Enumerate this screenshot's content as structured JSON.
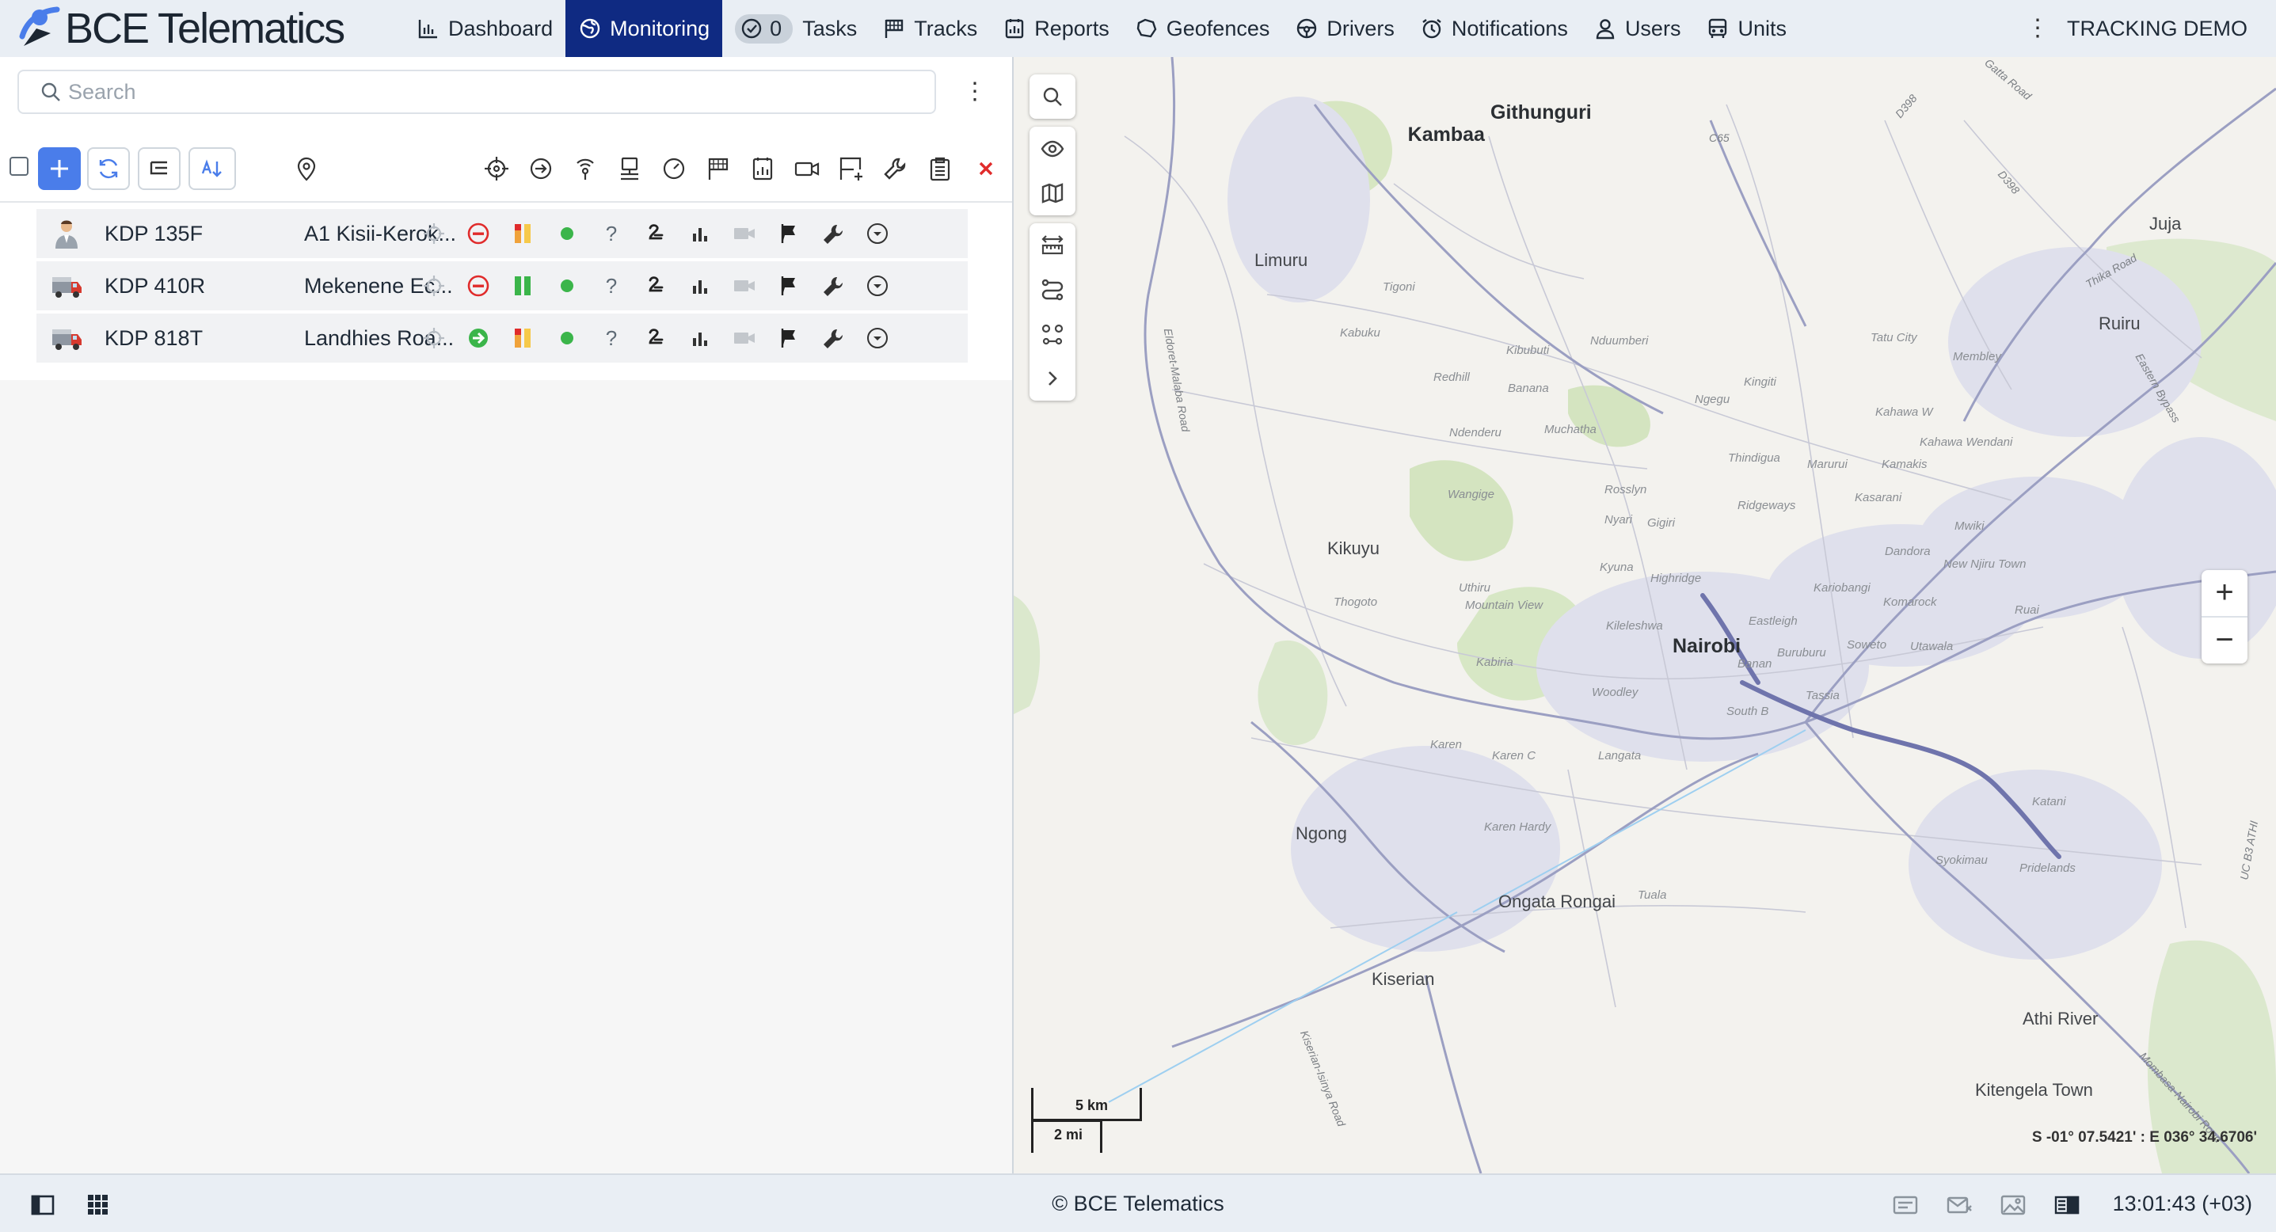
{
  "app": {
    "logo_text": "BCE Telematics",
    "account": "TRACKING DEMO"
  },
  "nav": {
    "dashboard": "Dashboard",
    "monitoring": "Monitoring",
    "tasks_count": "0",
    "tasks": "Tasks",
    "tracks": "Tracks",
    "reports": "Reports",
    "geofences": "Geofences",
    "drivers": "Drivers",
    "notifications": "Notifications",
    "users": "Users",
    "units": "Units"
  },
  "search": {
    "placeholder": "Search"
  },
  "units": [
    {
      "name": "KDP 135F",
      "address": "A1 Kisii-Kerok...",
      "icon": "person-icon",
      "status": "stopped",
      "fuel": "low",
      "online": true
    },
    {
      "name": "KDP 410R",
      "address": "Mekenene Ec...",
      "icon": "truck-icon",
      "status": "stopped",
      "fuel": "full",
      "online": true
    },
    {
      "name": "KDP 818T",
      "address": "Landhies Roa...",
      "icon": "truck-icon",
      "status": "moving",
      "fuel": "low",
      "online": true
    }
  ],
  "map": {
    "places": {
      "githunguri": "Githunguri",
      "kambaa": "Kambaa",
      "limuru": "Limuru",
      "kikuyu": "Kikuyu",
      "nairobi": "Nairobi",
      "ngong": "Ngong",
      "ongata_rongai": "Ongata Rongai",
      "kiserian": "Kiserian",
      "athi_river": "Athi River",
      "kitengela": "Kitengela Town",
      "juja": "Juja",
      "ruiru": "Ruiru"
    },
    "minor_places": {
      "tigoni": "Tigoni",
      "kabuku": "Kabuku",
      "kibubuti": "Kibubuti",
      "nduumberi": "Nduumberi",
      "redhill": "Redhill",
      "banana": "Banana",
      "kingiti": "Kingiti",
      "tatu_city": "Tatu City",
      "membley": "Membley",
      "ngegu": "Ngegu",
      "kahawa_w": "Kahawa W",
      "ndenderu": "Ndenderu",
      "muchatha": "Muchatha",
      "thindigua": "Thindigua",
      "marurui": "Marurui",
      "wangige": "Wangige",
      "rosslyn": "Rosslyn",
      "gigiri": "Gigiri",
      "nyari": "Nyari",
      "ridgeways": "Ridgeways",
      "kasarani": "Kasarani",
      "mwiki": "Mwiki",
      "dandora": "Dandora",
      "uthiru": "Uthiru",
      "kyuna": "Kyuna",
      "highridge": "Highridge",
      "kariobangi": "Kariobangi",
      "komarock": "Komarock",
      "thogoto": "Thogoto",
      "mountain_view": "Mountain View",
      "kileleshwa": "Kileleshwa",
      "eastleigh": "Eastleigh",
      "buruburu": "Buruburu",
      "soweto": "Soweto",
      "kabiria": "Kabiria",
      "woodley": "Woodley",
      "banda": "Banan",
      "tassia": "Tassia",
      "utawala": "Utawala",
      "south_b": "South B",
      "karen": "Karen",
      "karen_c": "Karen C",
      "langata": "Langata",
      "katani": "Katani",
      "karen_hardy": "Karen Hardy",
      "syokimau": "Syokimau",
      "pridelands": "Pridelands",
      "tuala": "Tuala",
      "kamakis": "Kamakis",
      "ruai": "Ruai",
      "new_njiru_town": "New Njiru Town",
      "juja_wendani": "Kahawa Wendani"
    },
    "roads": {
      "c65": "C65",
      "d398": "D398",
      "d398b": "D398",
      "thika_road": "Thika Road",
      "eastern_bypass": "Eastern Bypass",
      "limuru_road": "Eldoret-Malaba Road",
      "kiserian_road": "Kiserian-Isinya Road",
      "mombasa_road": "Mombasa-Nairobi Road",
      "b3_athi": "UC B3 ATHI",
      "gatta_road": "Gatta Road"
    },
    "scale_km": "5 km",
    "scale_mi": "2 mi",
    "coords": "S -01° 07.5421' : E 036° 34.6706'",
    "zoom_in": "+",
    "zoom_out": "−"
  },
  "footer": {
    "copyright": "© BCE Telematics",
    "clock": "13:01:43 (+03)"
  },
  "colors": {
    "brand_blue": "#0f2a82",
    "accent_blue": "#4a7dea",
    "online_green": "#3bb54a",
    "stop_red": "#e02b2b",
    "close_red": "#e02b2b"
  }
}
